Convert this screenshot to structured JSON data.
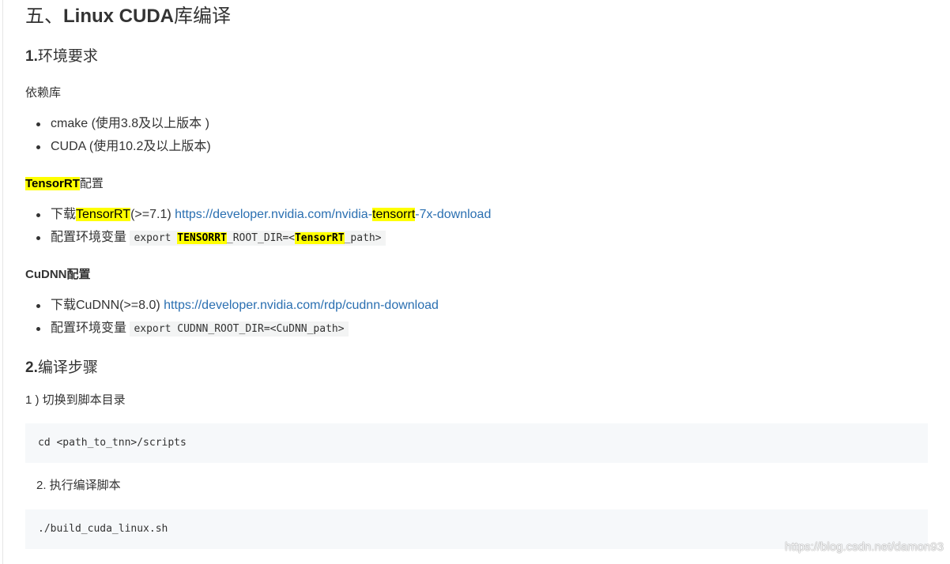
{
  "heading_main": {
    "prefix": "五、",
    "latin": "Linux CUDA",
    "suffix": "库编译"
  },
  "section1": {
    "num": "1.",
    "title": "环境要求"
  },
  "deps": {
    "label": "依赖库",
    "items": [
      "cmake (使用3.8及以上版本 )",
      "CUDA (使用10.2及以上版本)"
    ]
  },
  "tensorrt": {
    "label_hl": "TensorRT",
    "label_rest": "配置",
    "item1": {
      "prefix": "下载",
      "name_hl": "TensorRT",
      "version": "(>=7.1) ",
      "link_a": "https://developer.nvidia.com/nvidia-",
      "link_hl": "tensorrt",
      "link_b": "-7x-download"
    },
    "item2": {
      "prefix": "配置环境变量 ",
      "code_a": "export ",
      "code_hl1": "TENSORRT",
      "code_b": "_ROOT_DIR=<",
      "code_hl2": "TensorRT",
      "code_c": "_path>"
    }
  },
  "cudnn": {
    "label": "CuDNN配置",
    "item1": {
      "prefix": "下载CuDNN(>=8.0) ",
      "link": "https://developer.nvidia.com/rdp/cudnn-download"
    },
    "item2": {
      "prefix": "配置环境变量 ",
      "code": "export CUDNN_ROOT_DIR=<CuDNN_path>"
    }
  },
  "section2": {
    "num": "2.",
    "title": "编译步骤"
  },
  "step1": {
    "label": "1 ) 切换到脚本目录",
    "code": "cd <path_to_tnn>/scripts"
  },
  "step2": {
    "label": "2. 执行编译脚本",
    "code": "./build_cuda_linux.sh"
  },
  "watermark": "https://blog.csdn.net/damon93"
}
